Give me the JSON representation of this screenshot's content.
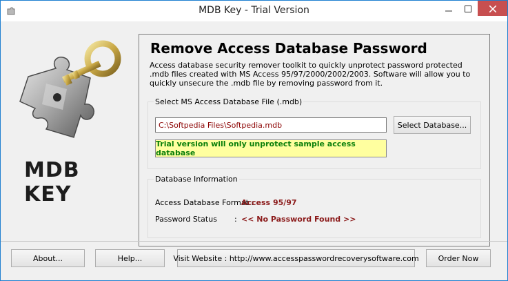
{
  "window": {
    "title": "MDB Key - Trial Version"
  },
  "logo": {
    "text": "MDB KEY"
  },
  "main": {
    "heading": "Remove Access Database Password",
    "description": "Access database security remover toolkit to quickly unprotect password protected .mdb files created with MS Access 95/97/2000/2002/2003. Software will allow you to quickly unsecure the .mdb file by removing password from it.",
    "file_group": {
      "label": "Select MS Access Database File (.mdb)",
      "path_value": "C:\\Softpedia Files\\Softpedia.mdb",
      "select_button": "Select Database...",
      "trial_note": "Trial version will only unprotect sample access database"
    },
    "info_group": {
      "label": "Database Information",
      "format_label": "Access Database Format :",
      "format_value": "Access 95/97",
      "status_label": "Password Status",
      "status_colon": ":",
      "status_value": "<< No Password Found >>"
    }
  },
  "buttons": {
    "about": "About...",
    "help": "Help...",
    "visit": "Visit Website : http://www.accesspasswordrecoverysoftware.com",
    "order": "Order Now"
  },
  "colors": {
    "accent_border": "#1e7fd0",
    "close_button": "#c74f50",
    "trial_note_bg": "#ffff9f",
    "trial_note_text": "#0a7f0a",
    "info_value": "#8b1a1a"
  },
  "icons": [
    "app-icon",
    "minimize-icon",
    "maximize-icon",
    "close-icon",
    "key-puzzle-logo"
  ]
}
